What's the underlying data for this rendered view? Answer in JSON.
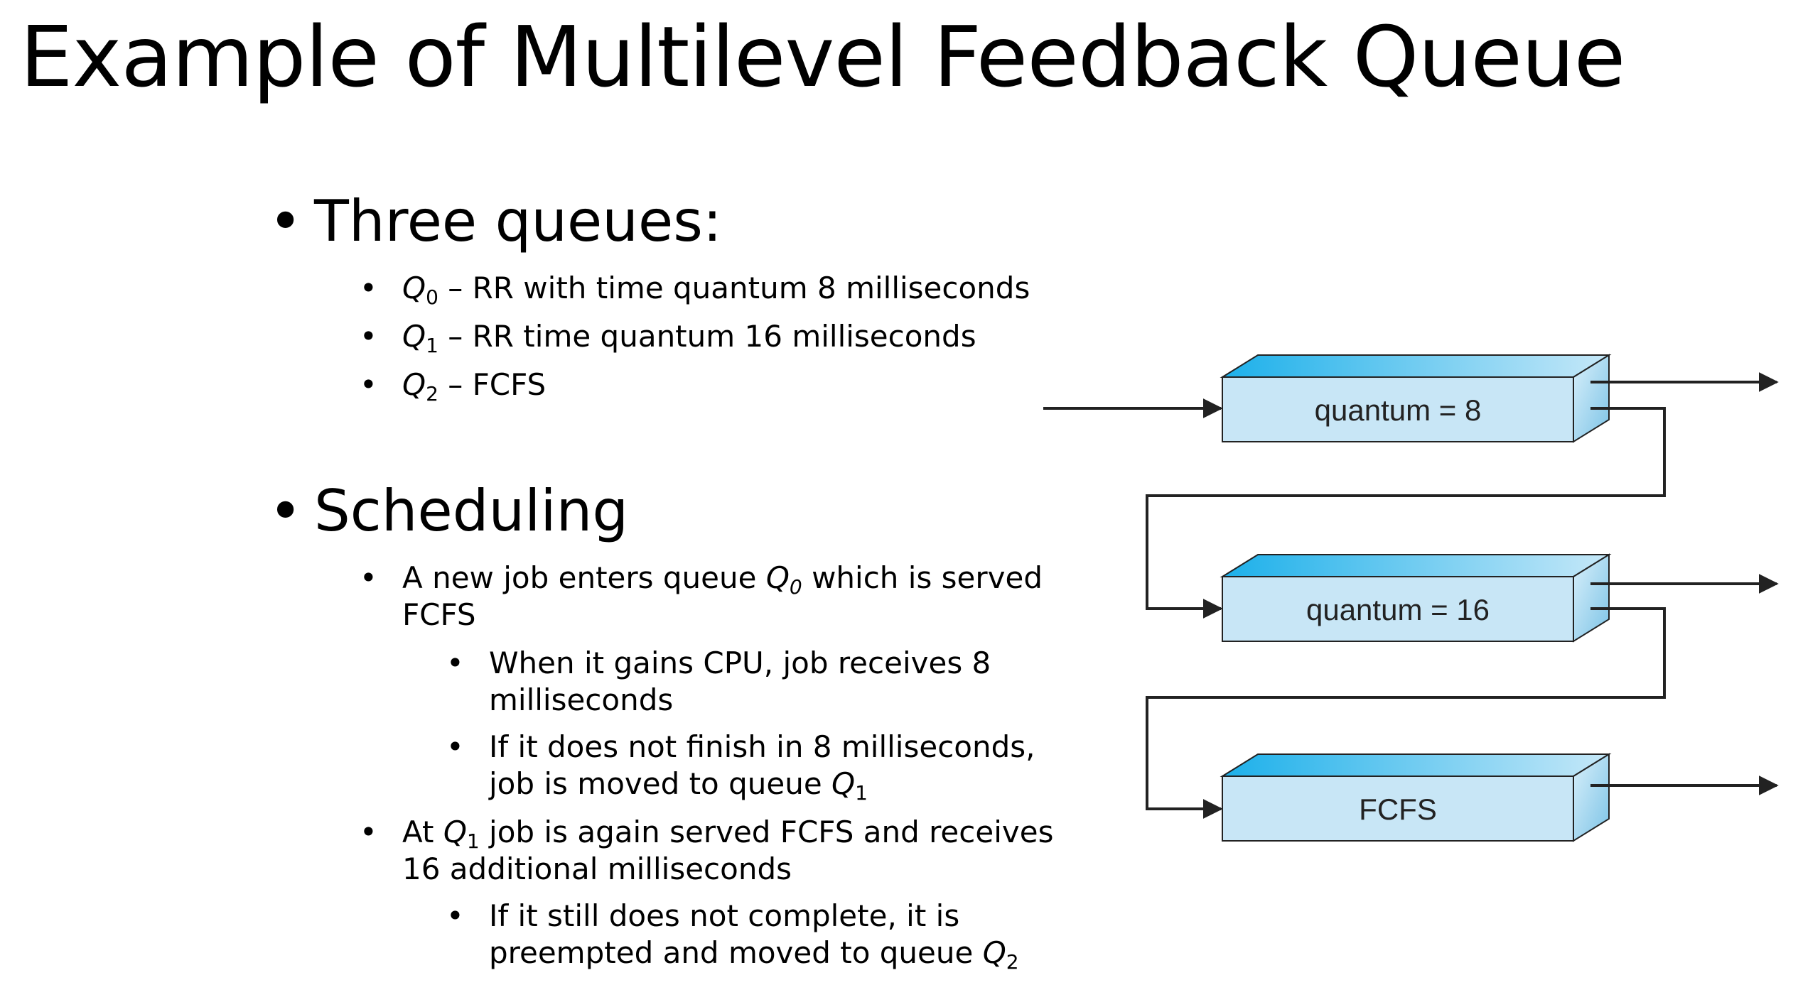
{
  "title": "Example of Multilevel Feedback Queue",
  "bullet_char": "•",
  "sections": {
    "queues": {
      "header": "Three queues:",
      "items": [
        {
          "queue": "Q",
          "sub": "0",
          "text": " – RR with time quantum 8 milliseconds"
        },
        {
          "queue": "Q",
          "sub": "1",
          "text": " – RR time quantum 16 milliseconds"
        },
        {
          "queue": "Q",
          "sub": "2",
          "text": " – FCFS"
        }
      ]
    },
    "scheduling": {
      "header": "Scheduling",
      "item1": {
        "line1_pre": "A new job enters queue ",
        "queue": "Q",
        "sub": "0",
        "line1_post": " which is served",
        "line2": "FCFS"
      },
      "item1a": {
        "line1": "When it gains CPU, job receives 8",
        "line2": "milliseconds"
      },
      "item1b": {
        "line1": "If it does not finish in 8 milliseconds,",
        "line2_pre": "job is moved to queue ",
        "queue": "Q",
        "sub": "1"
      },
      "item2": {
        "line1_pre": "At ",
        "queue": "Q",
        "sub": "1",
        "line1_post": " job is again served FCFS and receives",
        "line2": "16 additional milliseconds"
      },
      "item2a": {
        "line1": "If it still does not complete, it is",
        "line2_pre": "preempted and moved to queue ",
        "queue": "Q",
        "sub": "2"
      }
    }
  },
  "diagram": {
    "queues": [
      {
        "label": "quantum = 8"
      },
      {
        "label": "quantum = 16"
      },
      {
        "label": "FCFS"
      }
    ],
    "colors": {
      "box_front": "#c8e6f6",
      "box_top": "#1eb4ec",
      "box_side": "#8ccbe8",
      "line": "#222222"
    }
  }
}
